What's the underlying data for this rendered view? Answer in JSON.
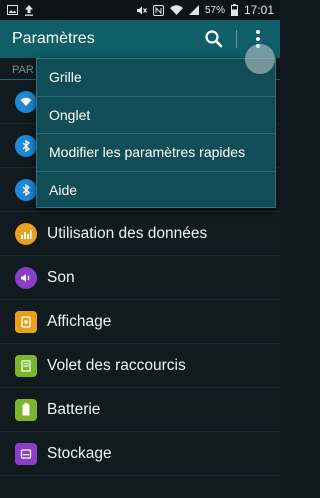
{
  "status_bar": {
    "battery_percent": "57%",
    "time": "17:01",
    "icons": [
      "image-icon",
      "upload-icon",
      "mute-icon",
      "nfc-icon",
      "wifi-icon",
      "signal-icon",
      "battery-icon"
    ]
  },
  "action_bar": {
    "title": "Paramètres",
    "icons": [
      "search-icon",
      "overflow-menu-icon"
    ],
    "color": "#0f5e68"
  },
  "list": {
    "section_header": "PAR",
    "items": [
      {
        "label": "",
        "icon": "wifi-icon",
        "color": "#1e88d6"
      },
      {
        "label": "",
        "icon": "bluetooth-like-icon",
        "color": "#1e88d6"
      },
      {
        "label": "",
        "icon": "bluetooth-icon",
        "color": "#1e88d6"
      },
      {
        "label": "Utilisation des données",
        "icon": "data-usage-icon",
        "color": "#e8a11f"
      },
      {
        "label": "Son",
        "icon": "sound-icon",
        "color": "#8b3fc9"
      },
      {
        "label": "Affichage",
        "icon": "display-icon",
        "color": "#e8a11f"
      },
      {
        "label": "Volet des raccourcis",
        "icon": "notification-panel-icon",
        "color": "#7cb52b"
      },
      {
        "label": "Batterie",
        "icon": "battery-icon",
        "color": "#7cb52b"
      },
      {
        "label": "Stockage",
        "icon": "storage-icon",
        "color": "#8b3fc9"
      }
    ]
  },
  "popup_menu": {
    "items": [
      "Grille",
      "Onglet",
      "Modifier les paramètres rapides",
      "Aide"
    ]
  }
}
